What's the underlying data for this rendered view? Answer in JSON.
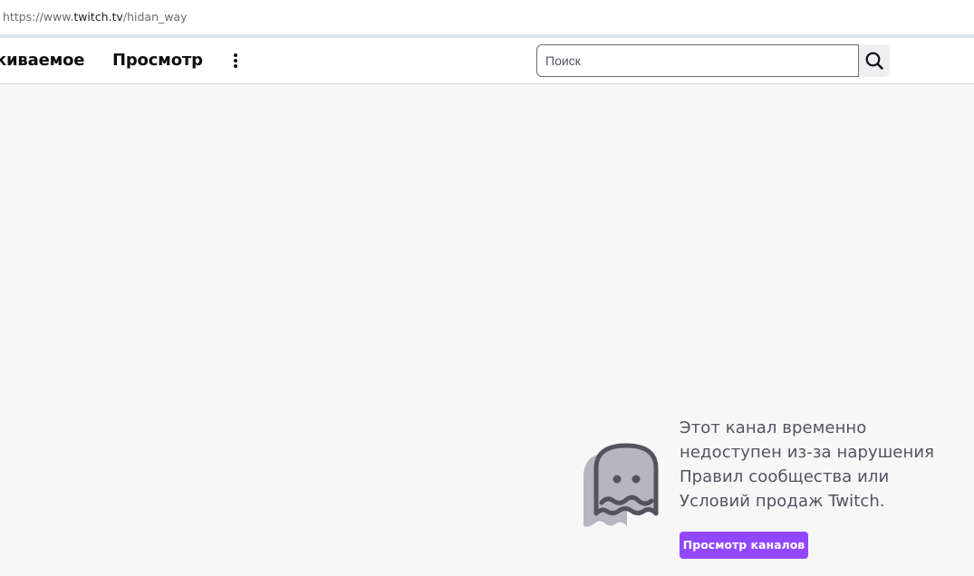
{
  "browser": {
    "url_prefix": "https://www.",
    "url_host": "twitch.tv",
    "url_path": "/hidan_way"
  },
  "nav": {
    "following_label": "киваемое",
    "browse_label": "Просмотр",
    "more_icon": "more-vertical-icon"
  },
  "search": {
    "placeholder": "Поиск",
    "value": "",
    "icon": "search-icon"
  },
  "notice": {
    "icon": "ghost-icon",
    "message": "Этот канал временно недоступен из-за нарушения Правил сообщества или Условий продаж Twitch.",
    "button_label": "Просмотр каналов"
  },
  "colors": {
    "accent": "#9147ff",
    "background": "#f7f7f8",
    "text_muted": "#53535f"
  }
}
